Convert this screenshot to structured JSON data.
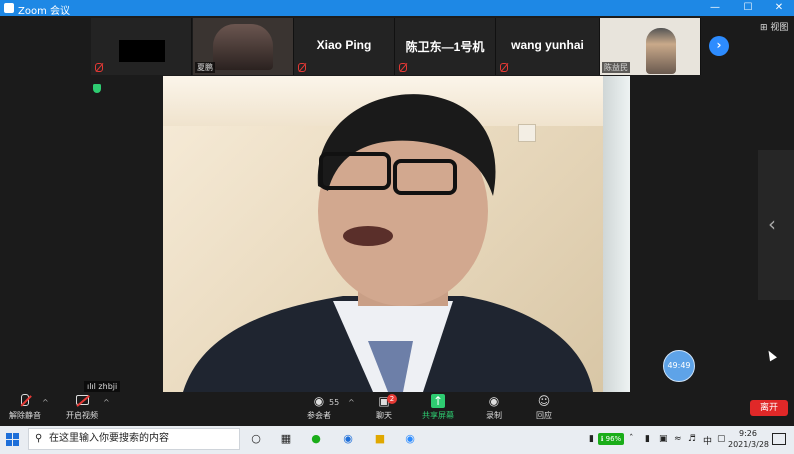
{
  "window": {
    "title": "Zoom 会议",
    "min": "—",
    "max": "☐",
    "close": "✕"
  },
  "view_button": "⊞ 视图",
  "participants": [
    {
      "name": "",
      "tag": ""
    },
    {
      "name": "",
      "tag": "夏鹏"
    },
    {
      "name": "Xiao Ping",
      "tag": ""
    },
    {
      "name": "陈卫东—1号机",
      "tag": ""
    },
    {
      "name": "wang yunhai",
      "tag": ""
    },
    {
      "name": "",
      "tag": "陈益民"
    }
  ],
  "next_page_icon": "›",
  "side_toggle_icon": "‹",
  "speaker_chip": "ılıl zhbji",
  "timer": "49:49",
  "toolbar": {
    "unmute": {
      "icon": "mic-off-icon",
      "label": "解除静音"
    },
    "video": {
      "icon": "camera-off-icon",
      "label": "开启视频"
    },
    "participants": {
      "icon": "people-icon",
      "label": "参会者",
      "count": "55"
    },
    "chat": {
      "icon": "chat-icon",
      "label": "聊天",
      "badge": "2"
    },
    "share": {
      "icon": "share-icon",
      "label": "共享屏幕"
    },
    "record": {
      "icon": "record-icon",
      "label": "录制"
    },
    "reactions": {
      "icon": "smile-icon",
      "label": "回应"
    },
    "caret": "^",
    "leave": "离开"
  },
  "taskbar": {
    "search_placeholder": "在这里输入你要搜索的内容",
    "wechat_pill": "ℹ 96%",
    "ime": "中",
    "time": "9:26",
    "date": "2021/3/28"
  },
  "colors": {
    "zoom_blue": "#2d8cff",
    "share_green": "#2ecc71",
    "leave_red": "#e02828"
  }
}
